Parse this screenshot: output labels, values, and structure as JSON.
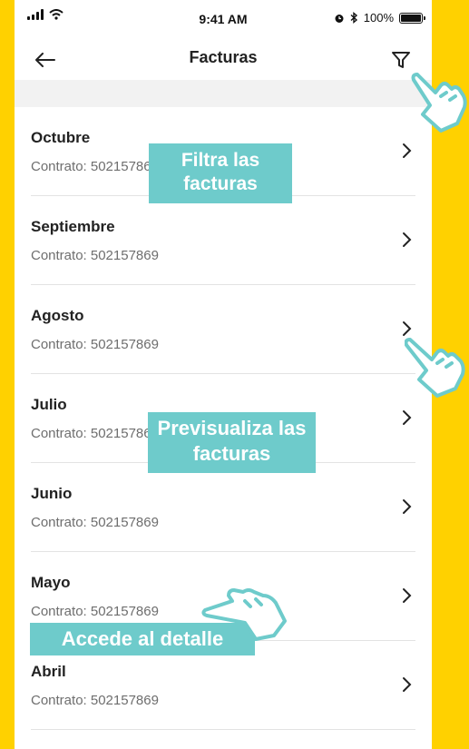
{
  "status_bar": {
    "time": "9:41 AM",
    "battery": "100%"
  },
  "header": {
    "title": "Facturas"
  },
  "invoices": [
    {
      "month": "Octubre",
      "contract": "Contrato: 502157869"
    },
    {
      "month": "Septiembre",
      "contract": "Contrato: 502157869"
    },
    {
      "month": "Agosto",
      "contract": "Contrato: 502157869"
    },
    {
      "month": "Julio",
      "contract": "Contrato: 502157869"
    },
    {
      "month": "Junio",
      "contract": "Contrato: 502157869"
    },
    {
      "month": "Mayo",
      "contract": "Contrato: 502157869"
    },
    {
      "month": "Abril",
      "contract": "Contrato: 502157869"
    }
  ],
  "callouts": {
    "filter": "Filtra las facturas",
    "preview": "Previsualiza las facturas",
    "detail": "Accede al detalle"
  },
  "colors": {
    "background": "#FFD100",
    "callout": "#6ECBCB"
  },
  "icons": [
    "back-arrow-icon",
    "filter-icon",
    "chevron-right-icon",
    "pointing-hand-icon"
  ]
}
